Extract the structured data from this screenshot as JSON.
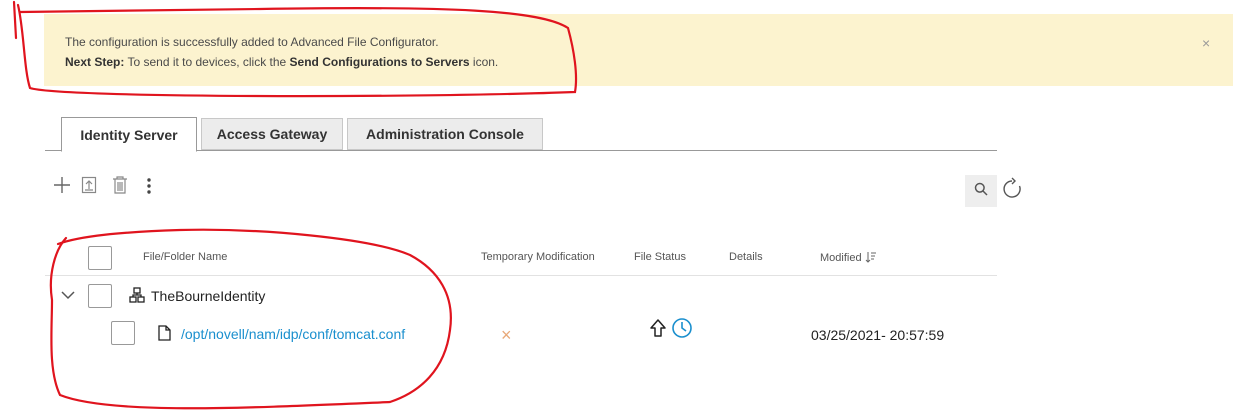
{
  "banner": {
    "message": "The configuration is successfully added to Advanced File Configurator.",
    "next_step_label": "Next Step:",
    "next_step_text_before": " To send it to devices, click the ",
    "next_step_action": "Send Configurations to Servers",
    "next_step_text_after": " icon.",
    "close_symbol": "×"
  },
  "tabs": [
    {
      "label": "Identity Server",
      "active": true
    },
    {
      "label": "Access Gateway",
      "active": false
    },
    {
      "label": "Administration Console",
      "active": false
    }
  ],
  "toolbar": {
    "icons": [
      "add-icon",
      "export-icon",
      "delete-icon",
      "more-options-icon",
      "search-icon",
      "refresh-icon"
    ]
  },
  "table": {
    "columns": {
      "name": "File/Folder Name",
      "temp_mod": "Temporary Modification",
      "file_status": "File Status",
      "details": "Details",
      "modified": "Modified"
    },
    "server_row": {
      "name": "TheBourneIdentity"
    },
    "file_row": {
      "path": "/opt/novell/nam/idp/conf/tomcat.conf",
      "temporary_modification": "×",
      "modified": "03/25/2021- 20:57:59"
    }
  },
  "colors": {
    "banner_bg": "#fcf3cf",
    "link": "#1a8fce",
    "annotation": "#e0141e",
    "temp_mod_x": "#e8a878"
  }
}
